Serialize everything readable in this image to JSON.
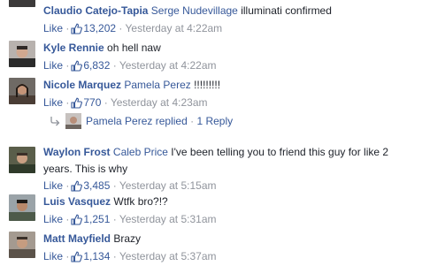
{
  "separator": "·",
  "comments": [
    {
      "author": "Claudio Catejo-Tapia",
      "tag": "Serge Nudevillage",
      "text": "illuminati confirmed",
      "like_label": "Like",
      "like_count": "13,202",
      "time": "Yesterday at 4:22am"
    },
    {
      "author": "Kyle Rennie",
      "tag": "",
      "text": "oh hell naw",
      "like_label": "Like",
      "like_count": "6,832",
      "time": "Yesterday at 4:22am"
    },
    {
      "author": "Nicole Marquez",
      "tag": "Pamela Perez",
      "text": "!!!!!!!!!",
      "like_label": "Like",
      "like_count": "770",
      "time": "Yesterday at 4:23am",
      "reply": {
        "name": "Pamela Perez",
        "action": "replied",
        "count": "1 Reply"
      }
    },
    {
      "author": "Waylon Frost",
      "tag": "Caleb Price",
      "text": "I've been telling you to friend this guy for like 2 years. This is why",
      "like_label": "Like",
      "like_count": "3,485",
      "time": "Yesterday at 5:15am"
    },
    {
      "author": "Luis Vasquez",
      "tag": "",
      "text": "Wtfk bro?!?",
      "like_label": "Like",
      "like_count": "1,251",
      "time": "Yesterday at 5:31am"
    },
    {
      "author": "Matt Mayfield",
      "tag": "",
      "text": "Brazy",
      "like_label": "Like",
      "like_count": "1,134",
      "time": "Yesterday at 5:37am"
    }
  ],
  "colors": {
    "link": "#365899",
    "meta": "#90949c",
    "text": "#1d2129"
  }
}
